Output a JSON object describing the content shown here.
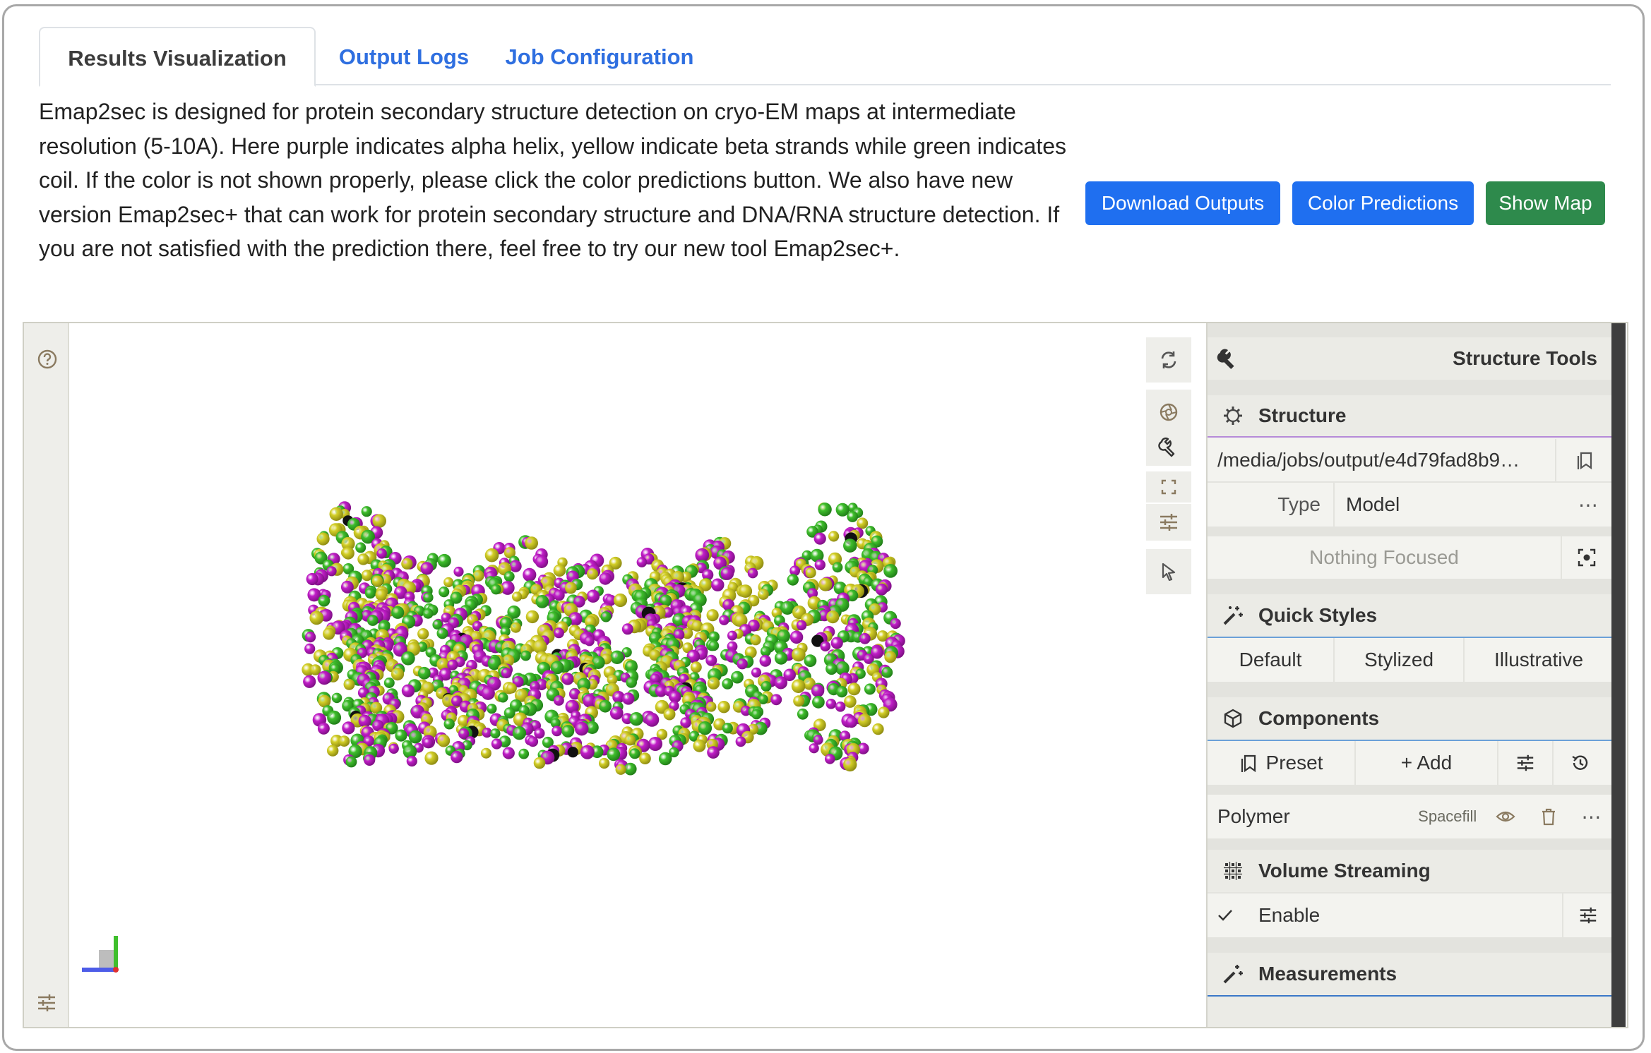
{
  "tabs": [
    {
      "label": "Results Visualization",
      "active": true
    },
    {
      "label": "Output Logs",
      "active": false
    },
    {
      "label": "Job Configuration",
      "active": false
    }
  ],
  "description": "Emap2sec is designed for protein secondary structure detection on cryo-EM maps at intermediate resolution (5-10A). Here purple indicates alpha helix, yellow indicate beta strands while green indicates coil. If the color is not shown properly, please click the color predictions button. We also have new version Emap2sec+ that can work for protein secondary structure and DNA/RNA structure detection. If you are not satisfied with the prediction there, feel free to try our new tool Emap2sec+.",
  "actions": {
    "download": "Download Outputs",
    "color": "Color Predictions",
    "show_map": "Show Map"
  },
  "colors": {
    "helix": "#c21ec9",
    "strand": "#d4d028",
    "coil": "#3fbf2c",
    "link": "#2f6fe0",
    "primary": "#1f6ff0",
    "success": "#2e8a4c"
  },
  "viewer": {
    "left_tools": [
      "help-icon",
      "settings-sliders-icon"
    ],
    "right_tools": [
      "reset-camera-icon",
      "screenshot-icon",
      "wrench-icon",
      "fullscreen-icon",
      "settings-sliders-icon",
      "selection-pointer-icon"
    ]
  },
  "panel": {
    "title": "Structure Tools",
    "structure": {
      "heading": "Structure",
      "path": "/media/jobs/output/e4d79fad8b9…",
      "type_label": "Type",
      "type_value": "Model",
      "focus": "Nothing Focused"
    },
    "quick_styles": {
      "heading": "Quick Styles",
      "options": [
        "Default",
        "Stylized",
        "Illustrative"
      ]
    },
    "components": {
      "heading": "Components",
      "preset": "Preset",
      "add": "+ Add",
      "item_name": "Polymer",
      "item_repr": "Spacefill"
    },
    "volume": {
      "heading": "Volume Streaming",
      "enable": "Enable"
    },
    "measurements": {
      "heading": "Measurements"
    }
  }
}
